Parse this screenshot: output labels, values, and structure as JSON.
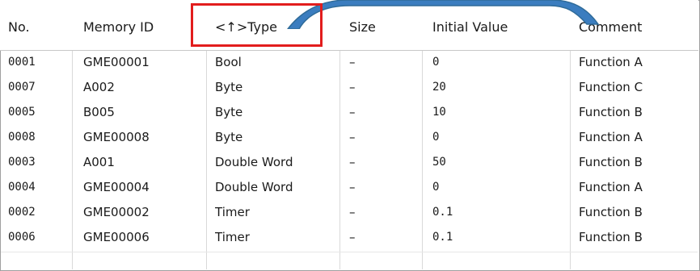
{
  "table": {
    "headers": {
      "no": "No.",
      "memory_id": "Memory ID",
      "type": "<↑>Type",
      "size": "Size",
      "initial_value": "Initial Value",
      "comment": "Comment"
    },
    "rows": [
      {
        "no": "0001",
        "memory_id": "GME00001",
        "type": "Bool",
        "size": "–",
        "initial_value": "0",
        "comment": "Function A"
      },
      {
        "no": "0007",
        "memory_id": "A002",
        "type": "Byte",
        "size": "–",
        "initial_value": "20",
        "comment": "Function C"
      },
      {
        "no": "0005",
        "memory_id": "B005",
        "type": "Byte",
        "size": "–",
        "initial_value": "10",
        "comment": "Function B"
      },
      {
        "no": "0008",
        "memory_id": "GME00008",
        "type": "Byte",
        "size": "–",
        "initial_value": "0",
        "comment": "Function A"
      },
      {
        "no": "0003",
        "memory_id": "A001",
        "type": "Double Word",
        "size": "–",
        "initial_value": "50",
        "comment": "Function B"
      },
      {
        "no": "0004",
        "memory_id": "GME00004",
        "type": "Double Word",
        "size": "–",
        "initial_value": "0",
        "comment": "Function A"
      },
      {
        "no": "0002",
        "memory_id": "GME00002",
        "type": "Timer",
        "size": "–",
        "initial_value": "0.1",
        "comment": "Function B"
      },
      {
        "no": "0006",
        "memory_id": "GME00006",
        "type": "Timer",
        "size": "–",
        "initial_value": "0.1",
        "comment": "Function B"
      }
    ]
  },
  "annotations": {
    "highlight_color": "#e21d1d",
    "callout_color": "#2f6b99"
  }
}
